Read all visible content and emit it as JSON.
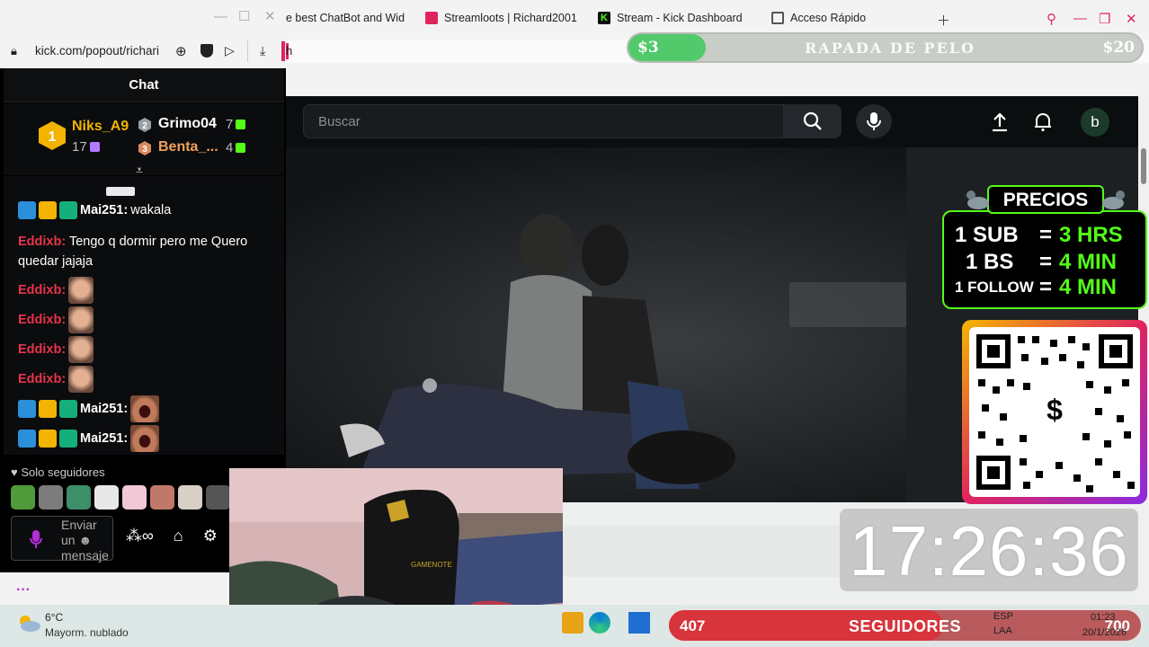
{
  "browser": {
    "tabs": [
      {
        "label": "e best ChatBot and Wid",
        "icon": "doc-icon",
        "color": "#e63a3a"
      },
      {
        "label": "Streamloots | Richard2001",
        "icon": "streamloots-icon",
        "color": "#e0245e"
      },
      {
        "label": "Stream - Kick Dashboard",
        "icon": "kick-icon",
        "color": "#53fc18"
      },
      {
        "label": "Acceso Rápido",
        "icon": "grid-icon",
        "color": "#555555"
      }
    ],
    "address_fragment": "h"
  },
  "chat_window": {
    "url": "kick.com/popout/richari",
    "title": "Chat",
    "leaderboard": {
      "first": {
        "rank": "1",
        "name": "Niks_A9",
        "count": "17"
      },
      "second": {
        "rank": "2",
        "name": "Grimo04",
        "count": "7"
      },
      "third": {
        "rank": "3",
        "name": "Benta_...",
        "count": "4"
      }
    },
    "messages": [
      {
        "user": "Mai251:",
        "text": "wakala",
        "badges": true,
        "user_color": "#ffffff"
      },
      {
        "user": "Eddixb:",
        "text": "Tengo q dormir pero me Quero",
        "text2": "quedar jajaja",
        "user_color": "#e6344a"
      },
      {
        "user": "Eddixb:",
        "emote": "face-emote",
        "user_color": "#e6344a"
      },
      {
        "user": "Eddixb:",
        "emote": "face-emote",
        "user_color": "#e6344a"
      },
      {
        "user": "Eddixb:",
        "emote": "face-emote",
        "user_color": "#e6344a"
      },
      {
        "user": "Eddixb:",
        "emote": "face-emote",
        "user_color": "#e6344a"
      },
      {
        "user": "Mai251:",
        "emote": "scream-emote",
        "badges": true,
        "user_color": "#ffffff"
      },
      {
        "user": "Mai251:",
        "emote": "scream-emote",
        "badges": true,
        "user_color": "#ffffff"
      }
    ],
    "followers_only": "Solo seguidores",
    "input_placeholder_1": "Enviar",
    "input_placeholder_2": "un",
    "input_placeholder_3": "mensaje"
  },
  "kick": {
    "search_placeholder": "Buscar",
    "avatar_letter": "b"
  },
  "overlays": {
    "donation_current": "$3",
    "donation_goal_label": "RAPADA DE PELO",
    "donation_goal": "$20",
    "prices_title": "PRECIOS",
    "prices": [
      {
        "item": "1 SUB",
        "eq": "=",
        "value": "3 HRS"
      },
      {
        "item": "1 BS",
        "eq": "=",
        "value": "4 MIN"
      },
      {
        "item": "1 FOLLOW",
        "eq": "=",
        "value": "4 MIN"
      }
    ],
    "timer": "17:26:36",
    "followers_current": "407",
    "followers_label": "SEGUIDORES",
    "followers_goal": "700",
    "followers_progress": 0.58,
    "donation_progress": 0.15
  },
  "taskbar": {
    "temperature": "6°C",
    "weather_desc": "Mayorm. nublado",
    "lang1": "ESP",
    "lang2": "LAA",
    "time": "01:23",
    "date": "20/1/2026"
  },
  "colors": {
    "kick_green": "#53fc18",
    "eddix_red": "#e6344a"
  }
}
